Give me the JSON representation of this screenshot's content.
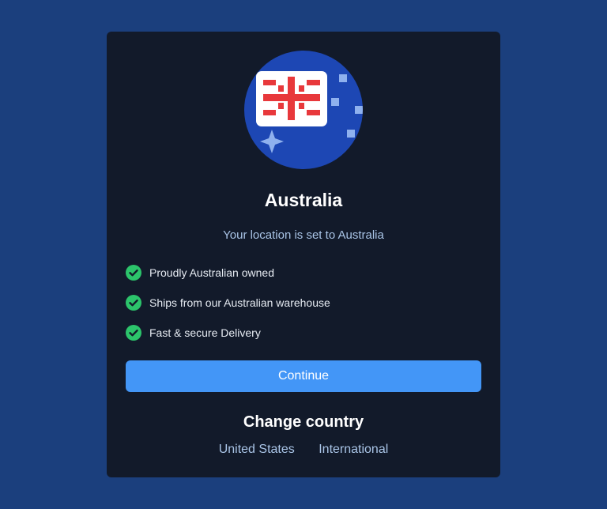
{
  "modal": {
    "title": "Australia",
    "subtitle": "Your location is set to Australia",
    "flag_icon": "australia-flag-icon"
  },
  "features": [
    {
      "icon": "check-circle-icon",
      "label": "Proudly Australian owned"
    },
    {
      "icon": "check-circle-icon",
      "label": "Ships from our Australian warehouse"
    },
    {
      "icon": "check-circle-icon",
      "label": "Fast & secure Delivery"
    }
  ],
  "continue_button": {
    "label": "Continue"
  },
  "change_country": {
    "heading": "Change country",
    "options": [
      "United States",
      "International"
    ]
  },
  "colors": {
    "page_background": "#1b3f7d",
    "card_background": "#121a2a",
    "flag_circle": "#1d47b4",
    "accent_button": "#4396f7",
    "check_green": "#2cc46b",
    "cross_red": "#e8383b",
    "link_text": "#a9c4e6"
  }
}
